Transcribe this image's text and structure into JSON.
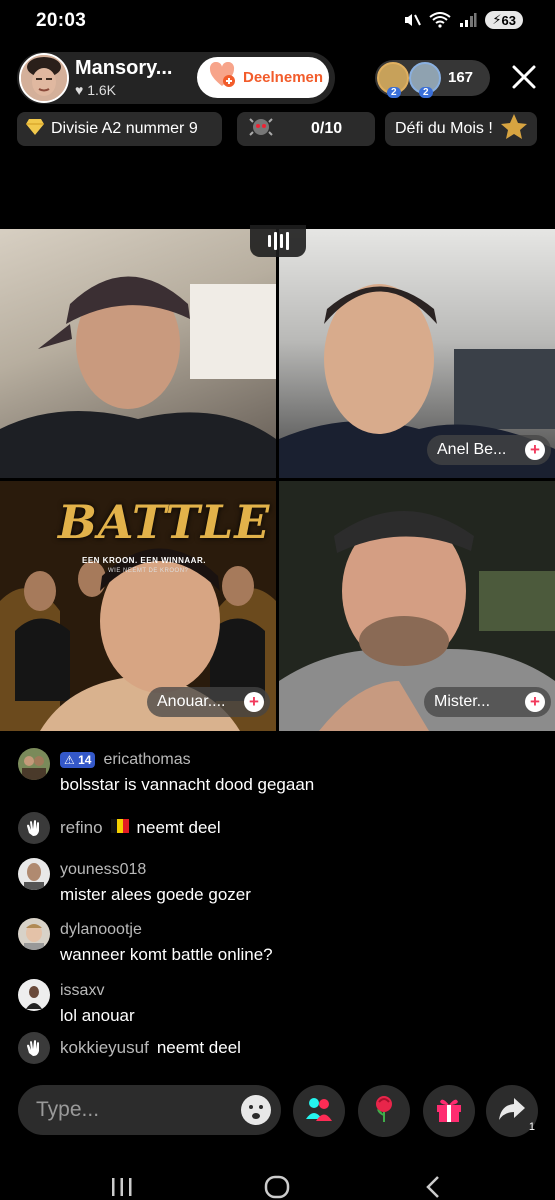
{
  "status_bar": {
    "time": "20:03",
    "battery": "63"
  },
  "header": {
    "host_name": "Mansory...",
    "host_likes": "1.6K",
    "join_label": "Deelnemen",
    "viewer_badges": [
      "2",
      "2"
    ],
    "viewer_count": "167"
  },
  "pills": {
    "division": "Divisie A2 nummer 9",
    "progress": "0/10",
    "challenge": "Défi du Mois !"
  },
  "grid": {
    "tiles": [
      {
        "name": ""
      },
      {
        "name": "Anel Be..."
      },
      {
        "name": "Anouar...."
      },
      {
        "name": "Mister..."
      }
    ],
    "battle_poster": {
      "title": "BATTLE",
      "tagline": "EEN KROON. EEN WINNAAR.",
      "subtagline": "WIE NEEMT DE KROON?"
    }
  },
  "comments": [
    {
      "user": "ericathomas",
      "badge_level": "14",
      "message": "bolsstar is vannacht dood gegaan"
    },
    {
      "user": "refino",
      "message": "neemt deel",
      "type": "join"
    },
    {
      "user": "youness018",
      "message": "mister alees goede gozer"
    },
    {
      "user": "dylanoootje",
      "message": "wanneer komt battle online?"
    },
    {
      "user": "issaxv",
      "message": "lol anouar"
    },
    {
      "user": "kokkieyusuf",
      "message": "neemt deel",
      "type": "join"
    }
  ],
  "bottom_bar": {
    "input_placeholder": "Type...",
    "share_count": "1"
  },
  "colors": {
    "join_orange": "#f25c2b",
    "plus_red": "#f23a5c",
    "badge_blue": "#3458c9",
    "gold": "#e2b24a"
  }
}
